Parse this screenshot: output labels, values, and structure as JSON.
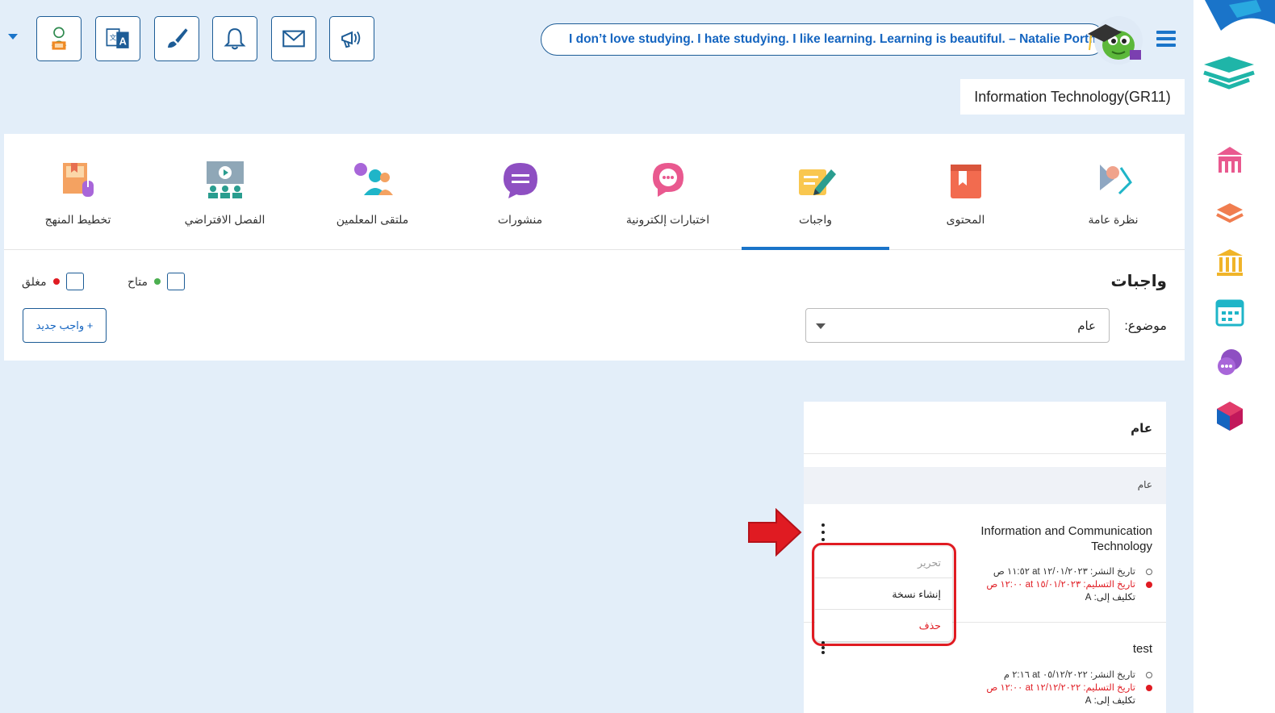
{
  "header": {
    "quote": "I don’t love studying. I hate studying. I like learning. Learning is beautiful. – Natalie Portman",
    "course": "Information Technology(GR11)",
    "toolbar_icons": [
      "student-reading-icon",
      "translate-icon",
      "brush-icon",
      "bell-icon",
      "mail-icon",
      "megaphone-icon"
    ]
  },
  "tabs": [
    {
      "label": "نظرة عامة",
      "icon": "overview-icon"
    },
    {
      "label": "المحتوى",
      "icon": "book-icon"
    },
    {
      "label": "واجبات",
      "icon": "homework-icon"
    },
    {
      "label": "اختبارات إلكترونية",
      "icon": "quiz-icon"
    },
    {
      "label": "منشورات",
      "icon": "posts-icon"
    },
    {
      "label": "ملتقى المعلمين",
      "icon": "teachers-forum-icon"
    },
    {
      "label": "الفصل الافتراضي",
      "icon": "virtual-class-icon"
    },
    {
      "label": "تخطيط المنهج",
      "icon": "curriculum-plan-icon"
    }
  ],
  "active_tab": "واجبات",
  "homework": {
    "title": "واجبات",
    "legend_available": "متاح",
    "legend_closed": "مغلق",
    "subject_label": "موضوع:",
    "subject_value": "عام",
    "new_button": "+ واجب جديد"
  },
  "card": {
    "header": "عام",
    "group": "عام",
    "items": [
      {
        "title": "Information and Communication Technology",
        "publish": "تاريخ النشر: ١٢/٠١/٢٠٢٣ at ١١:٥٢ ص",
        "due": "تاريخ التسليم: ١٥/٠١/٢٠٢٣ at ١٢:٠٠ ص",
        "assign": "تكليف إلى: A"
      },
      {
        "title": "test",
        "publish": "تاريخ النشر: ٠٥/١٢/٢٠٢٢ at ٢:١٦ م",
        "due": "تاريخ التسليم: ١٢/١٢/٢٠٢٢ at ١٢:٠٠ ص",
        "assign": "تكليف إلى: A"
      }
    ]
  },
  "menu": {
    "edit": "تحرير",
    "duplicate": "إنشاء نسخة",
    "delete": "حذف"
  },
  "colors": {
    "primary": "#1a74c9",
    "background": "#e3eef9",
    "available": "#4caf50",
    "closed": "#e01b22",
    "highlight": "#e01b22"
  }
}
